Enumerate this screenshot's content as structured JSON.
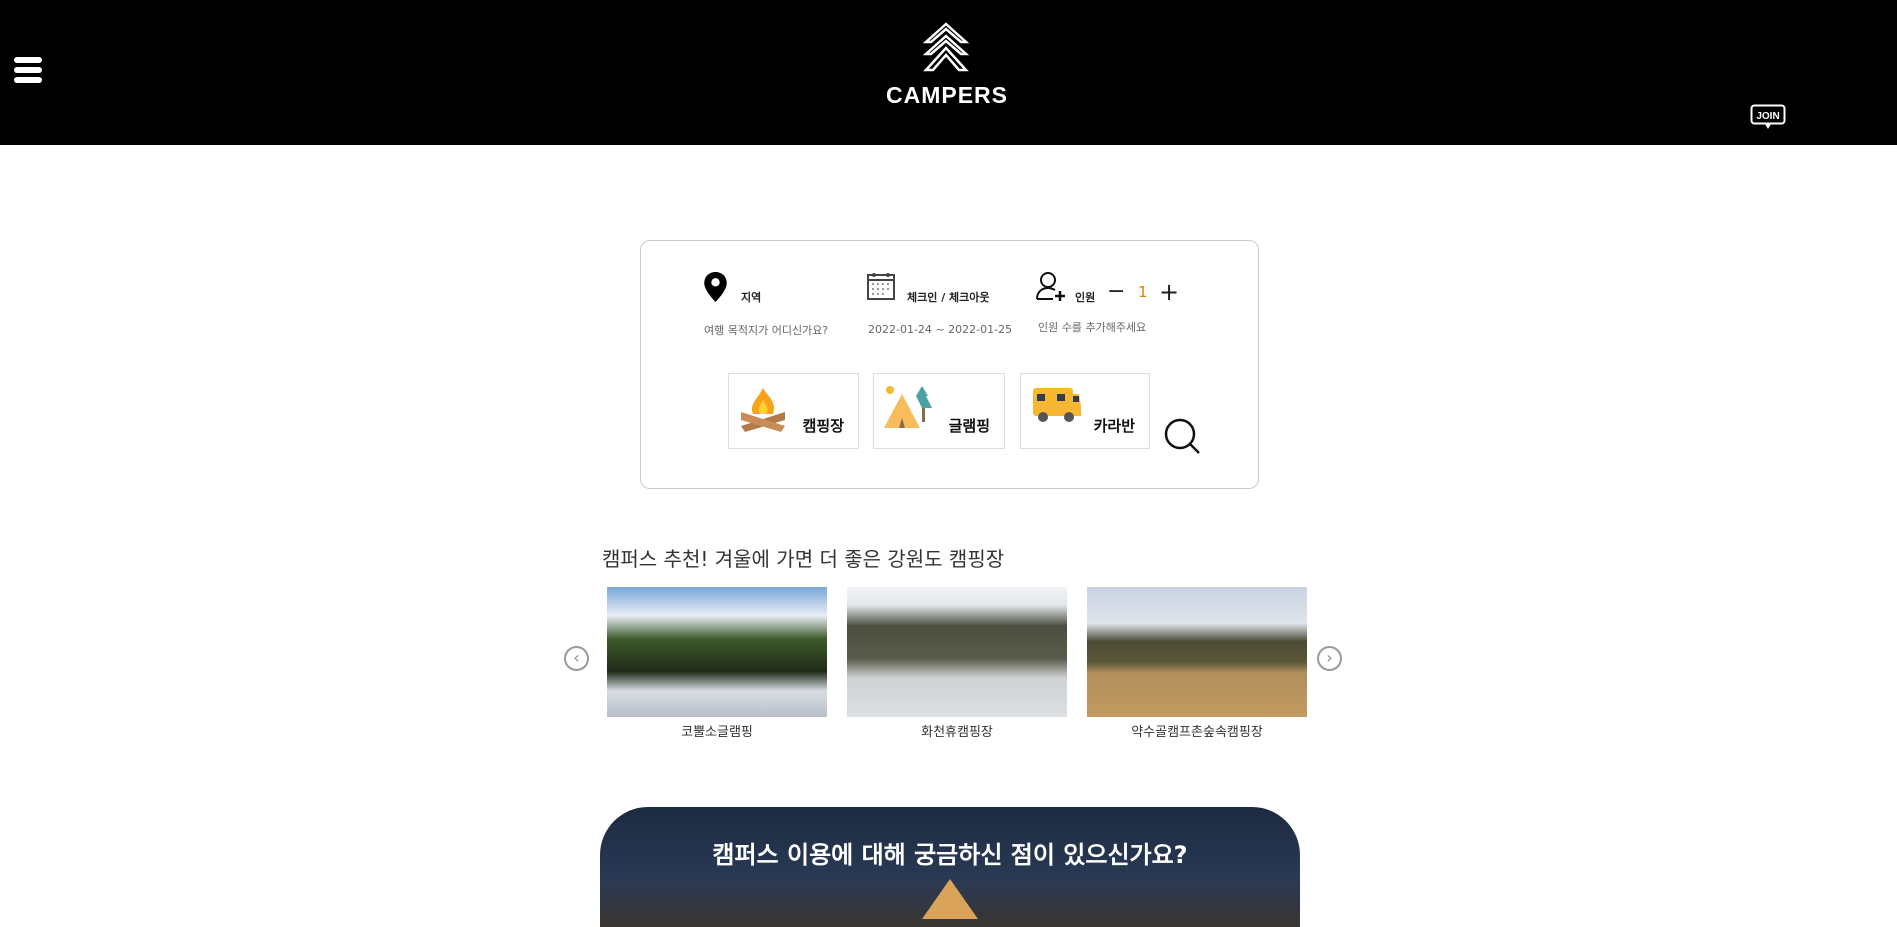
{
  "header": {
    "logo_text": "CAMPERS",
    "join_label": "JOIN"
  },
  "search": {
    "region_label": "지역",
    "region_placeholder": "여행 목적지가 어디신가요?",
    "date_label": "체크인 / 체크아웃",
    "date_value": "2022-01-24 ~ 2022-01-25",
    "people_label": "인원",
    "people_count": "1",
    "people_hint": "인원 수를 추가해주세요",
    "minus": "−",
    "plus": "+",
    "categories": [
      {
        "label": "캠핑장"
      },
      {
        "label": "글램핑"
      },
      {
        "label": "카라반"
      }
    ],
    "accent": "#d4820a"
  },
  "recommend": {
    "title": "캠퍼스 추천! 겨울에 가면 더 좋은 강원도 캠핑장",
    "items": [
      {
        "name": "코뿔소글램핑"
      },
      {
        "name": "화천휴캠핑장"
      },
      {
        "name": "약수골캠프촌숲속캠핑장"
      }
    ]
  },
  "banner": {
    "title": "캠퍼스 이용에 대해 궁금하신 점이 있으신가요?"
  }
}
